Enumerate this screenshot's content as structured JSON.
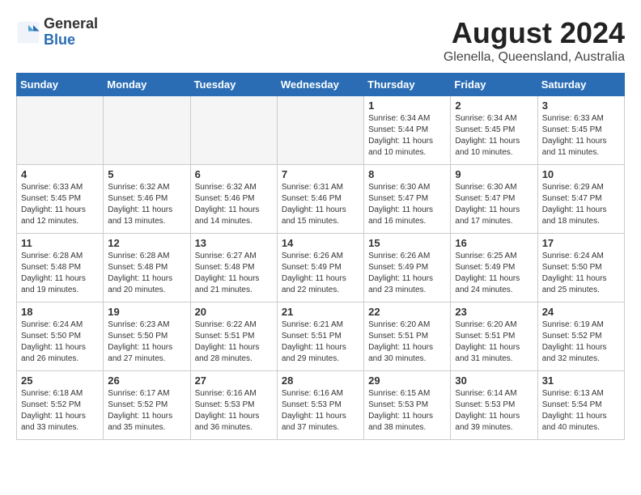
{
  "header": {
    "logo_general": "General",
    "logo_blue": "Blue",
    "month_year": "August 2024",
    "location": "Glenella, Queensland, Australia"
  },
  "weekdays": [
    "Sunday",
    "Monday",
    "Tuesday",
    "Wednesday",
    "Thursday",
    "Friday",
    "Saturday"
  ],
  "weeks": [
    [
      {
        "day": "",
        "info": ""
      },
      {
        "day": "",
        "info": ""
      },
      {
        "day": "",
        "info": ""
      },
      {
        "day": "",
        "info": ""
      },
      {
        "day": "1",
        "info": "Sunrise: 6:34 AM\nSunset: 5:44 PM\nDaylight: 11 hours\nand 10 minutes."
      },
      {
        "day": "2",
        "info": "Sunrise: 6:34 AM\nSunset: 5:45 PM\nDaylight: 11 hours\nand 10 minutes."
      },
      {
        "day": "3",
        "info": "Sunrise: 6:33 AM\nSunset: 5:45 PM\nDaylight: 11 hours\nand 11 minutes."
      }
    ],
    [
      {
        "day": "4",
        "info": "Sunrise: 6:33 AM\nSunset: 5:45 PM\nDaylight: 11 hours\nand 12 minutes."
      },
      {
        "day": "5",
        "info": "Sunrise: 6:32 AM\nSunset: 5:46 PM\nDaylight: 11 hours\nand 13 minutes."
      },
      {
        "day": "6",
        "info": "Sunrise: 6:32 AM\nSunset: 5:46 PM\nDaylight: 11 hours\nand 14 minutes."
      },
      {
        "day": "7",
        "info": "Sunrise: 6:31 AM\nSunset: 5:46 PM\nDaylight: 11 hours\nand 15 minutes."
      },
      {
        "day": "8",
        "info": "Sunrise: 6:30 AM\nSunset: 5:47 PM\nDaylight: 11 hours\nand 16 minutes."
      },
      {
        "day": "9",
        "info": "Sunrise: 6:30 AM\nSunset: 5:47 PM\nDaylight: 11 hours\nand 17 minutes."
      },
      {
        "day": "10",
        "info": "Sunrise: 6:29 AM\nSunset: 5:47 PM\nDaylight: 11 hours\nand 18 minutes."
      }
    ],
    [
      {
        "day": "11",
        "info": "Sunrise: 6:28 AM\nSunset: 5:48 PM\nDaylight: 11 hours\nand 19 minutes."
      },
      {
        "day": "12",
        "info": "Sunrise: 6:28 AM\nSunset: 5:48 PM\nDaylight: 11 hours\nand 20 minutes."
      },
      {
        "day": "13",
        "info": "Sunrise: 6:27 AM\nSunset: 5:48 PM\nDaylight: 11 hours\nand 21 minutes."
      },
      {
        "day": "14",
        "info": "Sunrise: 6:26 AM\nSunset: 5:49 PM\nDaylight: 11 hours\nand 22 minutes."
      },
      {
        "day": "15",
        "info": "Sunrise: 6:26 AM\nSunset: 5:49 PM\nDaylight: 11 hours\nand 23 minutes."
      },
      {
        "day": "16",
        "info": "Sunrise: 6:25 AM\nSunset: 5:49 PM\nDaylight: 11 hours\nand 24 minutes."
      },
      {
        "day": "17",
        "info": "Sunrise: 6:24 AM\nSunset: 5:50 PM\nDaylight: 11 hours\nand 25 minutes."
      }
    ],
    [
      {
        "day": "18",
        "info": "Sunrise: 6:24 AM\nSunset: 5:50 PM\nDaylight: 11 hours\nand 26 minutes."
      },
      {
        "day": "19",
        "info": "Sunrise: 6:23 AM\nSunset: 5:50 PM\nDaylight: 11 hours\nand 27 minutes."
      },
      {
        "day": "20",
        "info": "Sunrise: 6:22 AM\nSunset: 5:51 PM\nDaylight: 11 hours\nand 28 minutes."
      },
      {
        "day": "21",
        "info": "Sunrise: 6:21 AM\nSunset: 5:51 PM\nDaylight: 11 hours\nand 29 minutes."
      },
      {
        "day": "22",
        "info": "Sunrise: 6:20 AM\nSunset: 5:51 PM\nDaylight: 11 hours\nand 30 minutes."
      },
      {
        "day": "23",
        "info": "Sunrise: 6:20 AM\nSunset: 5:51 PM\nDaylight: 11 hours\nand 31 minutes."
      },
      {
        "day": "24",
        "info": "Sunrise: 6:19 AM\nSunset: 5:52 PM\nDaylight: 11 hours\nand 32 minutes."
      }
    ],
    [
      {
        "day": "25",
        "info": "Sunrise: 6:18 AM\nSunset: 5:52 PM\nDaylight: 11 hours\nand 33 minutes."
      },
      {
        "day": "26",
        "info": "Sunrise: 6:17 AM\nSunset: 5:52 PM\nDaylight: 11 hours\nand 35 minutes."
      },
      {
        "day": "27",
        "info": "Sunrise: 6:16 AM\nSunset: 5:53 PM\nDaylight: 11 hours\nand 36 minutes."
      },
      {
        "day": "28",
        "info": "Sunrise: 6:16 AM\nSunset: 5:53 PM\nDaylight: 11 hours\nand 37 minutes."
      },
      {
        "day": "29",
        "info": "Sunrise: 6:15 AM\nSunset: 5:53 PM\nDaylight: 11 hours\nand 38 minutes."
      },
      {
        "day": "30",
        "info": "Sunrise: 6:14 AM\nSunset: 5:53 PM\nDaylight: 11 hours\nand 39 minutes."
      },
      {
        "day": "31",
        "info": "Sunrise: 6:13 AM\nSunset: 5:54 PM\nDaylight: 11 hours\nand 40 minutes."
      }
    ]
  ]
}
